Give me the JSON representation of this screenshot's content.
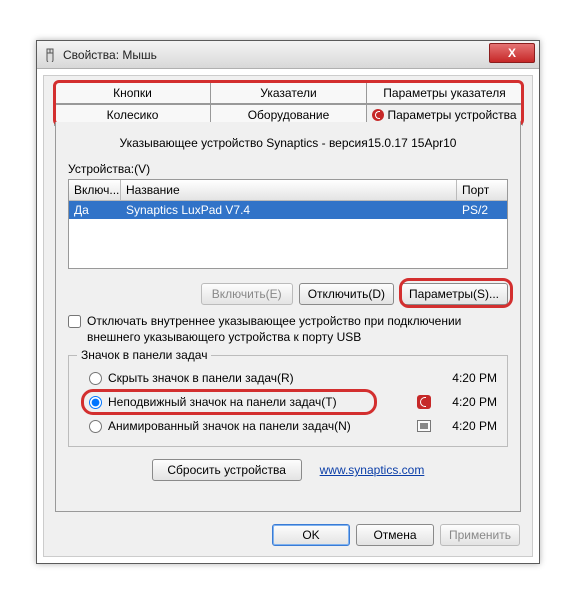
{
  "window": {
    "title": "Свойства: Мышь",
    "close_label": "X"
  },
  "tabs": {
    "row1": [
      "Кнопки",
      "Указатели",
      "Параметры указателя"
    ],
    "row2": [
      "Колесико",
      "Оборудование",
      "Параметры устройства"
    ]
  },
  "panel": {
    "desc": "Указывающее устройство Synaptics - версия15.0.17 15Apr10",
    "devices_label": "Устройства:(V)",
    "columns": {
      "enabled": "Включ...",
      "name": "Название",
      "port": "Порт"
    },
    "row": {
      "enabled": "Да",
      "name": "Synaptics LuxPad V7.4",
      "port": "PS/2"
    },
    "buttons": {
      "enable": "Включить(E)",
      "disable": "Отключить(D)",
      "params": "Параметры(S)..."
    },
    "checkbox": "Отключать внутреннее указывающее устройство при подключении внешнего указывающего устройства к порту USB"
  },
  "tray_group": {
    "legend": "Значок в панели задач",
    "options": {
      "hide": {
        "label": "Скрыть значок в панели задач(R)",
        "time": "4:20 PM"
      },
      "static": {
        "label": "Неподвижный значок на панели задач(T)",
        "time": "4:20 PM"
      },
      "anim": {
        "label": "Анимированный значок на панели задач(N)",
        "time": "4:20 PM"
      }
    }
  },
  "footer": {
    "reset": "Сбросить устройства",
    "link": "www.synaptics.com"
  },
  "dialog_buttons": {
    "ok": "OK",
    "cancel": "Отмена",
    "apply": "Применить"
  }
}
